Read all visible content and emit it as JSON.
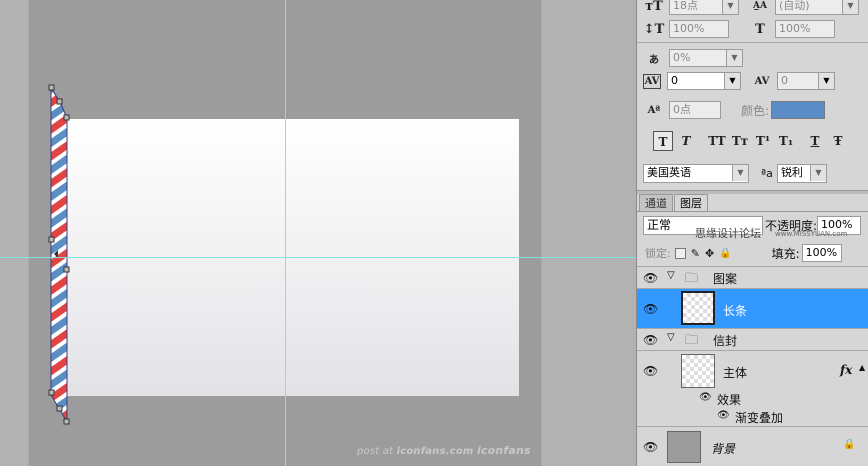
{
  "character_panel": {
    "font_size": "18点",
    "leading": "(自动)",
    "vertical_scale": "100%",
    "horizontal_scale": "100%",
    "tsume": "0%",
    "kerning": "0",
    "tracking": "0",
    "baseline_shift": "0点",
    "color_label": "颜色:",
    "color_value": "#5a8dc7",
    "language": "美国英语",
    "aa_label": "ªa",
    "antialias": "锐利",
    "style_buttons": [
      "T",
      "T",
      "TT",
      "Tт",
      "T¹",
      "T₁",
      "T",
      "Ŧ"
    ]
  },
  "layers_panel": {
    "tabs": [
      "通道",
      "图层"
    ],
    "blend_mode": "正常",
    "opacity_label": "不透明度:",
    "opacity_value": "100%",
    "lock_label": "锁定:",
    "fill_label": "填充:",
    "fill_value": "100%",
    "watermark": "思缘设计论坛",
    "watermark_url": "www.MISSYUAN.com",
    "group_1": "图案",
    "layer_stripe": "长条",
    "group_2": "信封",
    "layer_body": "主体",
    "fx_label": "fx",
    "effects_label": "效果",
    "effect_gradient": "渐变叠加",
    "layer_background": "背景",
    "selection_color": "#3399ff"
  },
  "canvas": {
    "watermark_prefix": "post at ",
    "watermark_site": "iconfans.com",
    "watermark_brand": "iconfans"
  }
}
